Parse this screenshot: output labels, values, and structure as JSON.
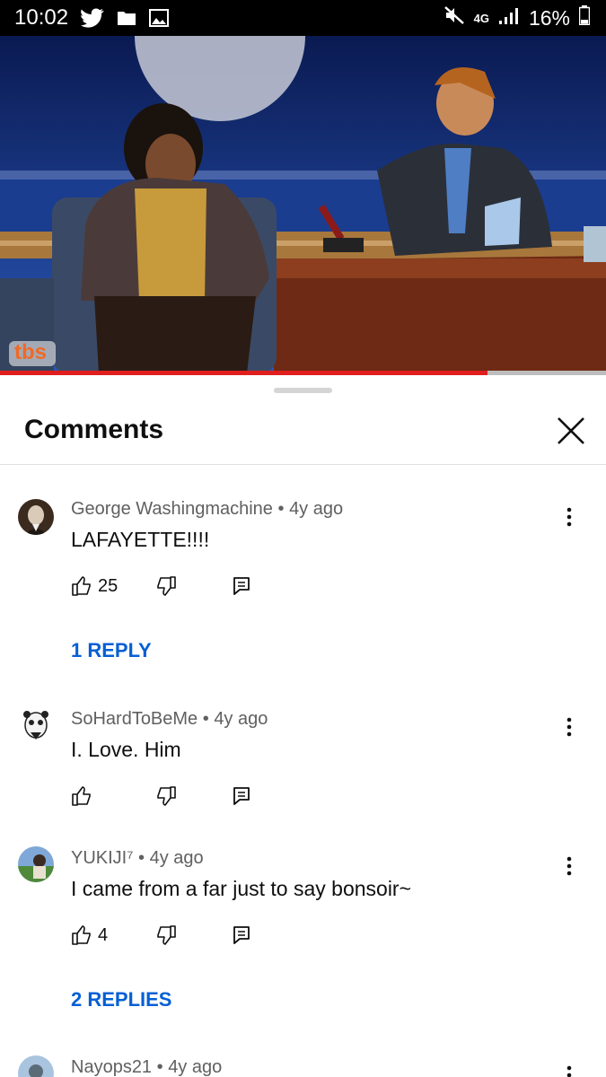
{
  "status_bar": {
    "time": "10:02",
    "icons_left": [
      "twitter-icon",
      "folder-icon",
      "gallery-icon"
    ],
    "icons_right": [
      "mute-icon",
      "signal-icon"
    ],
    "network": "4G",
    "battery": "16%"
  },
  "video": {
    "channel_logo": "tbs",
    "progress_fraction": 0.805,
    "progress_color": "#e01e1e"
  },
  "sheet": {
    "title": "Comments"
  },
  "comments": [
    {
      "author": "George Washingmachine",
      "age": "4y ago",
      "text": "LAFAYETTE!!!!",
      "likes": "25",
      "replies": "1 REPLY"
    },
    {
      "author": "SoHardToBeMe",
      "age": "4y ago",
      "text": "I. Love. Him",
      "likes": "",
      "replies": ""
    },
    {
      "author": "YUKIJI⁷",
      "age": "4y ago",
      "text": "I came from a far just to say bonsoir~",
      "likes": "4",
      "replies": "2 REPLIES"
    },
    {
      "author": "Nayops21",
      "age": "4y ago",
      "text": "",
      "likes": "",
      "replies": ""
    }
  ],
  "colors": {
    "accent_link": "#065fd4",
    "meta_text": "#606060"
  }
}
